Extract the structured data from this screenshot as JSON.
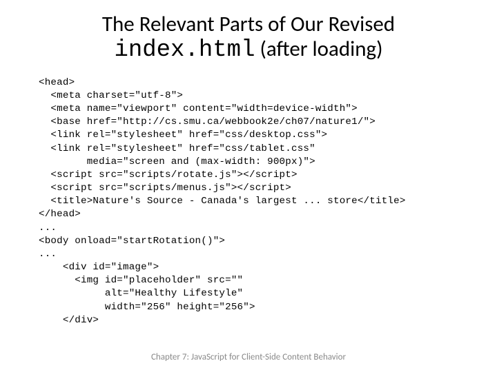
{
  "title_line1": "The Relevant Parts of Our Revised",
  "title_mono": "index.html",
  "title_line2_rest": " (after loading)",
  "code_lines": [
    "<head>",
    "  <meta charset=\"utf-8\">",
    "  <meta name=\"viewport\" content=\"width=device-width\">",
    "  <base href=\"http://cs.smu.ca/webbook2e/ch07/nature1/\">",
    "  <link rel=\"stylesheet\" href=\"css/desktop.css\">",
    "  <link rel=\"stylesheet\" href=\"css/tablet.css\"",
    "        media=\"screen and (max-width: 900px)\">",
    "  <script src=\"scripts/rotate.js\"></script>",
    "  <script src=\"scripts/menus.js\"></script>",
    "  <title>Nature's Source - Canada's largest ... store</title>",
    "</head>",
    "...",
    "<body onload=\"startRotation()\">",
    "...",
    "    <div id=\"image\">",
    "      <img id=\"placeholder\" src=\"\"",
    "           alt=\"Healthy Lifestyle\"",
    "           width=\"256\" height=\"256\">",
    "    </div>"
  ],
  "footer": "Chapter 7: JavaScript for Client-Side Content Behavior"
}
